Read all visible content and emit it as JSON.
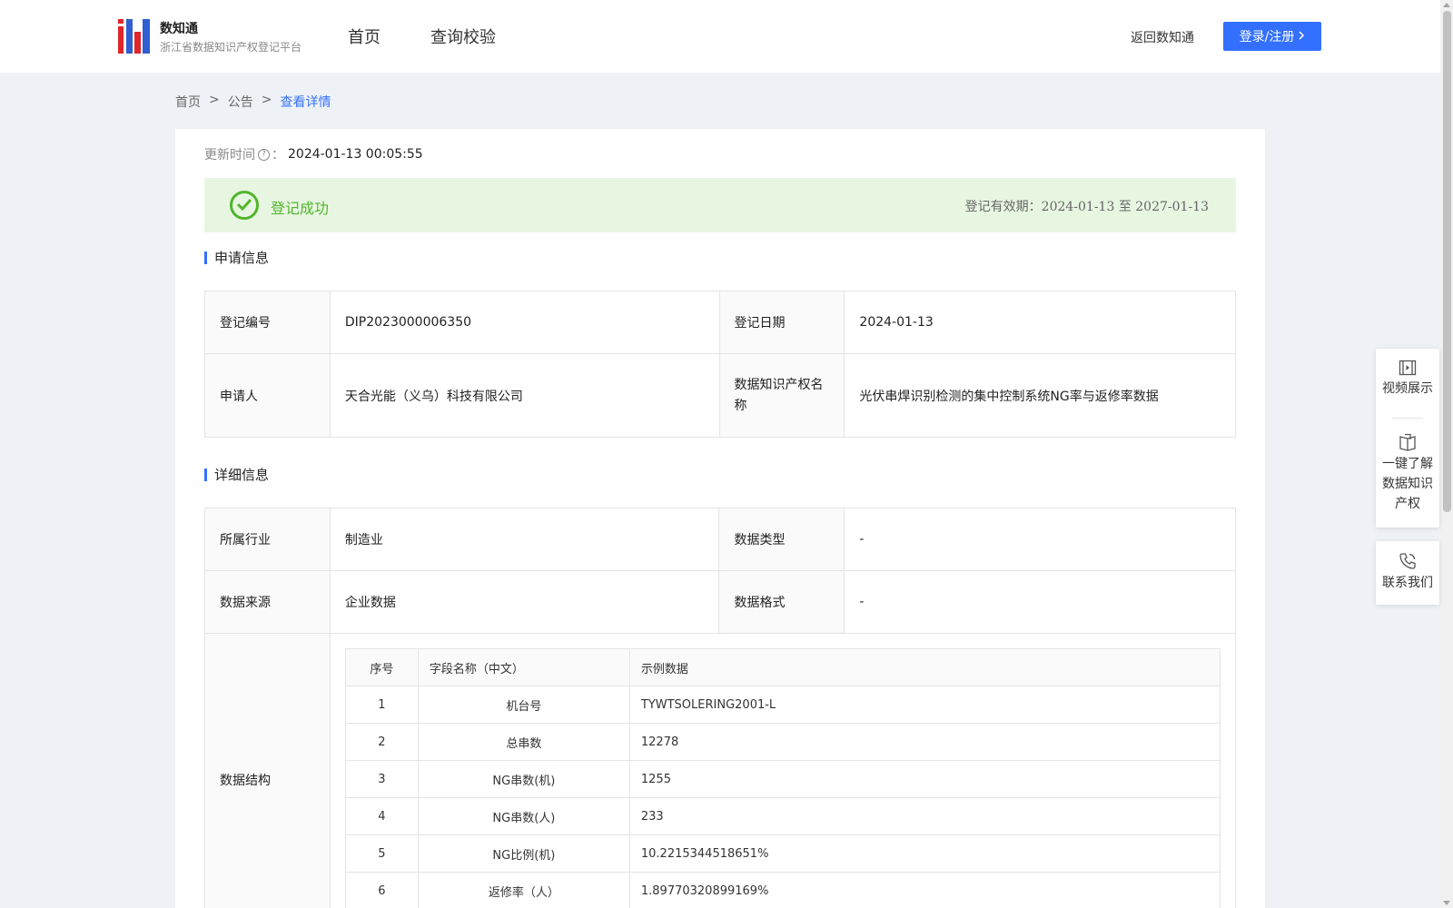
{
  "header": {
    "brand_name": "数知通",
    "brand_subtitle": "浙江省数据知识产权登记平台",
    "nav": [
      "首页",
      "查询校验"
    ],
    "back_link": "返回数知通",
    "login_button": "登录/注册"
  },
  "breadcrumb": {
    "items": [
      "首页",
      "公告"
    ],
    "current": "查看详情",
    "separator": ">"
  },
  "update": {
    "label": "更新时间",
    "colon": "：",
    "value": "2024-01-13 00:05:55"
  },
  "status": {
    "text": "登记成功",
    "validity_label": "登记有效期：",
    "validity_value": "2024-01-13 至 2027-01-13",
    "color": "#52b52d"
  },
  "application": {
    "title": "申请信息",
    "reg_no_label": "登记编号",
    "reg_no": "DIP2023000006350",
    "reg_date_label": "登记日期",
    "reg_date": "2024-01-13",
    "applicant_label": "申请人",
    "applicant": "天合光能（义乌）科技有限公司",
    "ip_name_label": "数据知识产权名称",
    "ip_name": "光伏串焊识别检测的集中控制系统NG率与返修率数据"
  },
  "details": {
    "title": "详细信息",
    "industry_label": "所属行业",
    "industry": "制造业",
    "data_type_label": "数据类型",
    "data_type": "-",
    "source_label": "数据来源",
    "source": "企业数据",
    "format_label": "数据格式",
    "format": "-",
    "structure_label": "数据结构"
  },
  "structure": {
    "headers": [
      "序号",
      "字段名称（中文）",
      "示例数据"
    ],
    "rows": [
      [
        "1",
        "机台号",
        "TYWTSOLERING2001-L"
      ],
      [
        "2",
        "总串数",
        "12278"
      ],
      [
        "3",
        "NG串数(机)",
        "1255"
      ],
      [
        "4",
        "NG串数(人)",
        "233"
      ],
      [
        "5",
        "NG比例(机)",
        "10.2215344518651%"
      ],
      [
        "6",
        "返修率（人）",
        "1.89770320899169%"
      ]
    ]
  },
  "side_panel": {
    "video": "视频展示",
    "learn": [
      "一键了解",
      "数据知识",
      "产权"
    ],
    "contact": "联系我们"
  },
  "colors": {
    "accent": "#3370ff",
    "success_bg": "#e7f6e1",
    "logo_blue": "#2f5fd0",
    "logo_red": "#e0262b"
  }
}
